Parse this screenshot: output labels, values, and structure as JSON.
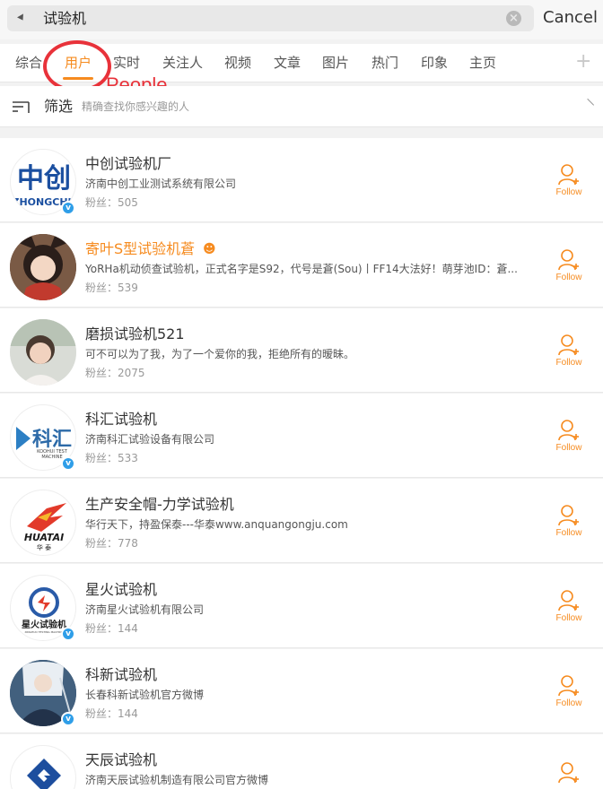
{
  "search": {
    "query": "试验机",
    "cancel_label": "Cancel"
  },
  "tabs": [
    {
      "label": "综合"
    },
    {
      "label": "用户"
    },
    {
      "label": "实时"
    },
    {
      "label": "关注人"
    },
    {
      "label": "视频"
    },
    {
      "label": "文章"
    },
    {
      "label": "图片"
    },
    {
      "label": "热门"
    },
    {
      "label": "印象"
    },
    {
      "label": "主页"
    }
  ],
  "annotation": {
    "text": "People"
  },
  "filter": {
    "label": "筛选",
    "hint": "精确查找你感兴趣的人"
  },
  "follow_label": "Follow",
  "colors": {
    "accent": "#f68b1f",
    "verified": "#2f9ee8",
    "annotation": "#e8323a"
  },
  "users": [
    {
      "name": "中创试验机厂",
      "desc": "济南中创工业测试系统有限公司",
      "fans": "粉丝：505",
      "verified": true
    },
    {
      "name": "寄叶S型试验机蒼",
      "desc": "YoRHa机动侦查试验机，正式名字是S92，代号是蒼(Sou)丨FF14大法好！萌芽池ID：蒼...",
      "fans": "粉丝：539",
      "verified": false
    },
    {
      "name": "磨损试验机521",
      "desc": "可不可以为了我，为了一个爱你的我，拒绝所有的暧昧。",
      "fans": "粉丝：2075",
      "verified": false
    },
    {
      "name": "科汇试验机",
      "desc": "济南科汇试验设备有限公司",
      "fans": "粉丝：533",
      "verified": true
    },
    {
      "name": "生产安全帽-力学试验机",
      "desc": "华行天下，持盈保泰---华泰www.anquangongju.com",
      "fans": "粉丝：778",
      "verified": false
    },
    {
      "name": "星火试验机",
      "desc": "济南星火试验机有限公司",
      "fans": "粉丝：144",
      "verified": true
    },
    {
      "name": "科新试验机",
      "desc": "长春科新试验机官方微博",
      "fans": "粉丝：144",
      "verified": true
    },
    {
      "name": "天辰试验机",
      "desc": "济南天辰试验机制造有限公司官方微博",
      "fans": "",
      "verified": false
    }
  ],
  "logos": {
    "zhongchuang": {
      "big": "中创",
      "small": "ZHONGCHU"
    },
    "kehui": {
      "big": "科汇",
      "line1": "KOOHUI TEST",
      "line2": "MACHINE"
    },
    "huatai": {
      "big": "HUATAI",
      "small": "华 泰"
    },
    "xinghuo": {
      "big": "星火试验机",
      "small": "XINGHUO TESTING MACHINE"
    }
  }
}
